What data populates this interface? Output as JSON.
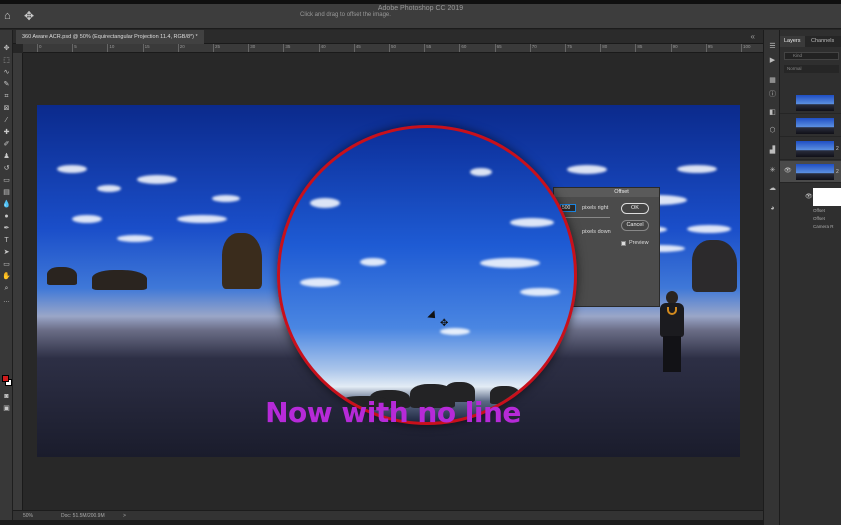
{
  "app": {
    "title": "Adobe Photoshop CC 2019",
    "hint": "Click and drag to offset the image."
  },
  "document": {
    "tab_title": "360 Aware ACR.psd @ 50% (Equirectangular Projection 11.4, RGB/8*) *",
    "rulers": [
      "0",
      "5",
      "10",
      "15",
      "20",
      "25",
      "30",
      "35",
      "40",
      "45",
      "50",
      "55",
      "60",
      "65",
      "70",
      "75",
      "80",
      "85",
      "90",
      "95",
      "100"
    ]
  },
  "offset_dialog": {
    "title": "Offset",
    "horizontal_value": "500",
    "horizontal_label": "pixels right",
    "vertical_label": "pixels down",
    "ok_label": "OK",
    "cancel_label": "Cancel",
    "preview_label": "Preview",
    "preview_checked": true
  },
  "caption": {
    "text": "Now with no line",
    "color": "#b62ad8"
  },
  "status": {
    "zoom": "50%",
    "doc_size": "Doc: 51.5M/200.9M",
    "arrow": ">"
  },
  "layers_panel": {
    "tabs": [
      "Layers",
      "Channels"
    ],
    "search_placeholder": "Kind",
    "blend_mode": "Normal",
    "layer_labels": [
      "2",
      "2"
    ],
    "sub_layers": [
      "Offset",
      "Offset",
      "Camera R"
    ]
  },
  "colors": {
    "accent_ring": "#c8101b",
    "foreground": "#cf1b1b",
    "background": "#ffffff"
  }
}
